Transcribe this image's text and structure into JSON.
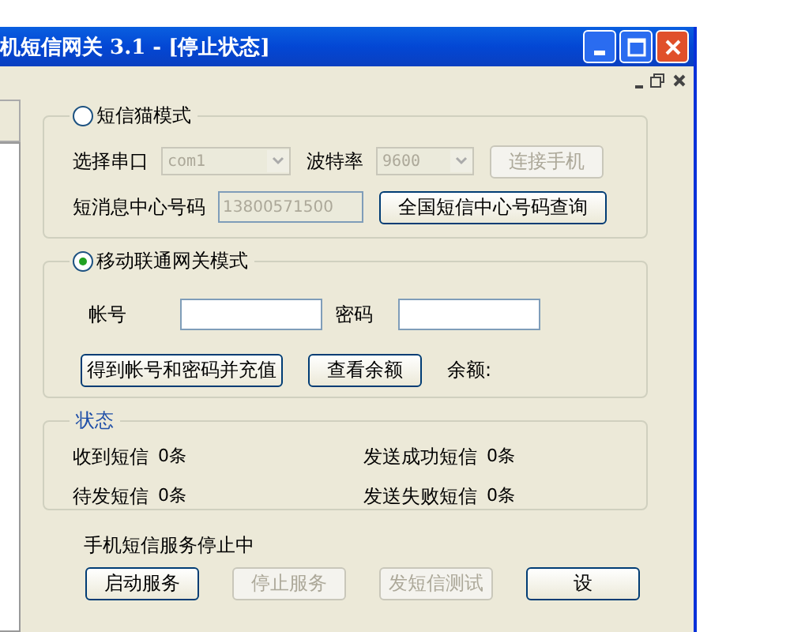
{
  "window": {
    "title": "机短信网关  3.1 - [停止状态]"
  },
  "modem_mode": {
    "label": "短信猫模式",
    "selected": false,
    "port_label": "选择串口",
    "port_value": "com1",
    "port_disabled": true,
    "baud_label": "波特率",
    "baud_value": "9600",
    "baud_disabled": true,
    "connect_button": {
      "label": "连接手机",
      "disabled": true
    },
    "center_label": "短消息中心号码",
    "center_value": "13800571500",
    "center_disabled": true,
    "query_button": {
      "label": "全国短信中心号码查询",
      "disabled": false
    }
  },
  "gateway_mode": {
    "label": "移动联通网关模式",
    "selected": true,
    "account_label": "帐号",
    "password_label": "密码",
    "recharge_button": {
      "label": "得到帐号和密码并充值",
      "disabled": false
    },
    "balance_button": {
      "label": "查看余额",
      "disabled": false
    },
    "balance_label": "余额:"
  },
  "status": {
    "title": "状态",
    "items": [
      {
        "label": "收到短信",
        "value": "0条"
      },
      {
        "label": "发送成功短信",
        "value": "0条"
      },
      {
        "label": "待发短信",
        "value": "0条"
      },
      {
        "label": "发送失败短信",
        "value": "0条"
      }
    ]
  },
  "service_message": "手机短信服务停止中",
  "buttons": [
    {
      "label": "启动服务",
      "disabled": false
    },
    {
      "label": "停止服务",
      "disabled": true
    },
    {
      "label": "发短信测试",
      "disabled": true
    },
    {
      "label": "设",
      "disabled": false
    }
  ]
}
